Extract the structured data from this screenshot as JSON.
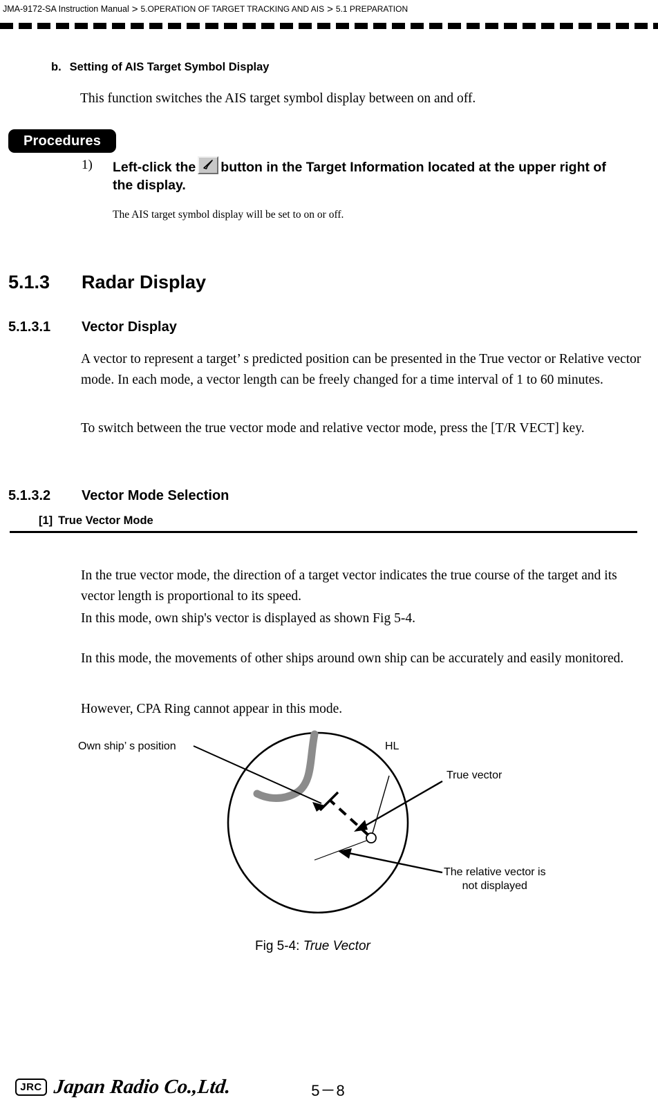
{
  "header": {
    "manual": "JMA-9172-SA Instruction Manual",
    "separator": ">",
    "chapter": "5.OPERATION OF TARGET TRACKING AND AIS",
    "section": "5.1  PREPARATION"
  },
  "section_b": {
    "letter": "b.",
    "title": "Setting of AIS Target Symbol Display",
    "intro": "This function switches the AIS target symbol display between on and off."
  },
  "procedures": {
    "badge": "Procedures",
    "step_number": "1)",
    "step_text_before": "Left-click the",
    "step_icon_name": "ais-target-symbol-button",
    "step_text_after": "button in the Target Information located at the upper right of the display.",
    "step_note": "The AIS target symbol display will be set to on or off."
  },
  "section_513": {
    "number": "5.1.3",
    "title": "Radar Display"
  },
  "section_5131": {
    "number": "5.1.3.1",
    "title": "Vector Display",
    "paragraph1": "A vector to represent a target’ s predicted position can be presented in the True vector or Relative vector mode.  In each mode, a vector length can be freely changed for a time interval of 1 to 60 minutes.",
    "paragraph2": "To switch between the true vector mode and relative vector mode, press the [T/R VECT] key."
  },
  "section_5132": {
    "number": "5.1.3.2",
    "title": "Vector Mode Selection",
    "bracket_number": "[1]",
    "bracket_title": "True Vector Mode",
    "paragraph1": "In the true vector mode, the direction of a target vector indicates the true course of the target and its vector length is proportional to its speed.",
    "paragraph2": "In this mode, own ship's vector is displayed as shown Fig 5-4.",
    "paragraph3": "In this mode, the movements of other ships around own ship can be accurately and easily monitored.",
    "paragraph4": "However, CPA Ring cannot appear in this mode."
  },
  "figure": {
    "label_own_ship": "Own ship’ s position",
    "label_hl": "HL",
    "label_true_vector": "True vector",
    "label_relative_line1": "The relative vector is",
    "label_relative_line2": "not displayed",
    "caption_prefix": "Fig 5-4: ",
    "caption_italic": "True Vector",
    "colors": {
      "outline": "#000000",
      "sweep_arc": "#8c8c8c"
    }
  },
  "footer": {
    "logo_box": "JRC",
    "company": "Japan Radio Co.,Ltd.",
    "page": "5－8"
  }
}
